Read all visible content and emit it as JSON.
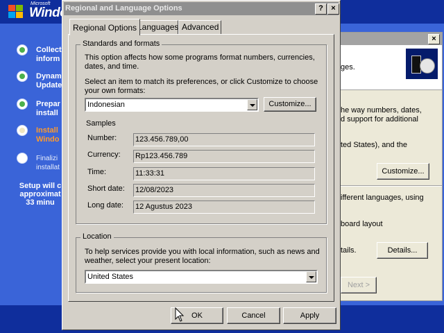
{
  "setup": {
    "logo_microsoft": "Microsoft",
    "logo_windows": "Windo",
    "steps": [
      {
        "label": "Collect\ninform",
        "state": "done"
      },
      {
        "label": "Dynam\nUpdate",
        "state": "done"
      },
      {
        "label": "Prepar\ninstall",
        "state": "done"
      },
      {
        "label": "Install\nWindo",
        "state": "active"
      },
      {
        "label": "Finalizi\ninstallat",
        "state": "pending"
      }
    ],
    "remaining": "Setup will c\napproximat\n33 minu"
  },
  "background_window": {
    "close_label": "×",
    "fragments": {
      "header": "ges.",
      "line1": "he way numbers, dates,",
      "line2": "d support for additional",
      "line3": "ted States), and the",
      "line4": "ifferent languages, using",
      "line5": "board layout",
      "line6": "tails."
    },
    "customize_label": "Customize...",
    "details_label": "Details...",
    "next_label": "Next >"
  },
  "dialog": {
    "title": "Regional and Language Options",
    "help_label": "?",
    "close_label": "×",
    "tabs": [
      {
        "label": "Regional Options",
        "selected": true
      },
      {
        "label": "Languages",
        "selected": false
      },
      {
        "label": "Advanced",
        "selected": false
      }
    ],
    "standards": {
      "group_title": "Standards and formats",
      "description": "This option affects how some programs format numbers, currencies, dates, and time.",
      "instruction": "Select an item to match its preferences, or click Customize to choose your own formats:",
      "selected_format": "Indonesian",
      "customize_label": "Customize...",
      "samples_title": "Samples",
      "samples": [
        {
          "label": "Number:",
          "value": "123.456.789,00"
        },
        {
          "label": "Currency:",
          "value": "Rp123.456.789"
        },
        {
          "label": "Time:",
          "value": "11:33:31"
        },
        {
          "label": "Short date:",
          "value": "12/08/2023"
        },
        {
          "label": "Long date:",
          "value": "12 Agustus 2023"
        }
      ]
    },
    "location": {
      "group_title": "Location",
      "description": "To help services provide you with local information, such as news and weather, select your present location:",
      "selected_location": "United States"
    },
    "buttons": {
      "ok": "OK",
      "cancel": "Cancel",
      "apply": "Apply"
    }
  },
  "colors": {
    "setup_blue": "#3a64d8",
    "setup_dark_blue": "#0f2e9c",
    "active_step": "#ff9a2c",
    "dialog_face": "#d4d0c8",
    "inactive_title": "#8f8f8f"
  }
}
